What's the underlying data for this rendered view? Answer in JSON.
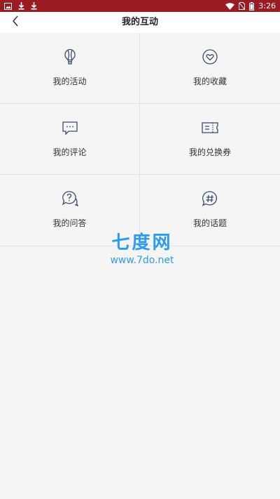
{
  "status_bar": {
    "time": "3:26",
    "colors": {
      "background": "#9b1b23",
      "foreground": "#ffffff"
    },
    "left_icons": [
      "image-notification-icon",
      "download-icon",
      "download-icon"
    ],
    "right_icons": [
      "wifi-icon",
      "no-sim-icon",
      "battery-icon"
    ]
  },
  "header": {
    "title": "我的互动",
    "back_icon": "chevron-left-icon"
  },
  "grid": {
    "items": [
      {
        "label": "我的活动",
        "icon": "balloon-icon"
      },
      {
        "label": "我的收藏",
        "icon": "heart-icon"
      },
      {
        "label": "我的评论",
        "icon": "comment-icon"
      },
      {
        "label": "我的兑换券",
        "icon": "ticket-icon"
      },
      {
        "label": "我的问答",
        "icon": "question-icon"
      },
      {
        "label": "我的话题",
        "icon": "hashtag-icon"
      }
    ],
    "icon_color": "#3a4a6b"
  },
  "watermark": {
    "title": "七度网",
    "url": "www.7do.net",
    "color": "#2d9cf0"
  }
}
